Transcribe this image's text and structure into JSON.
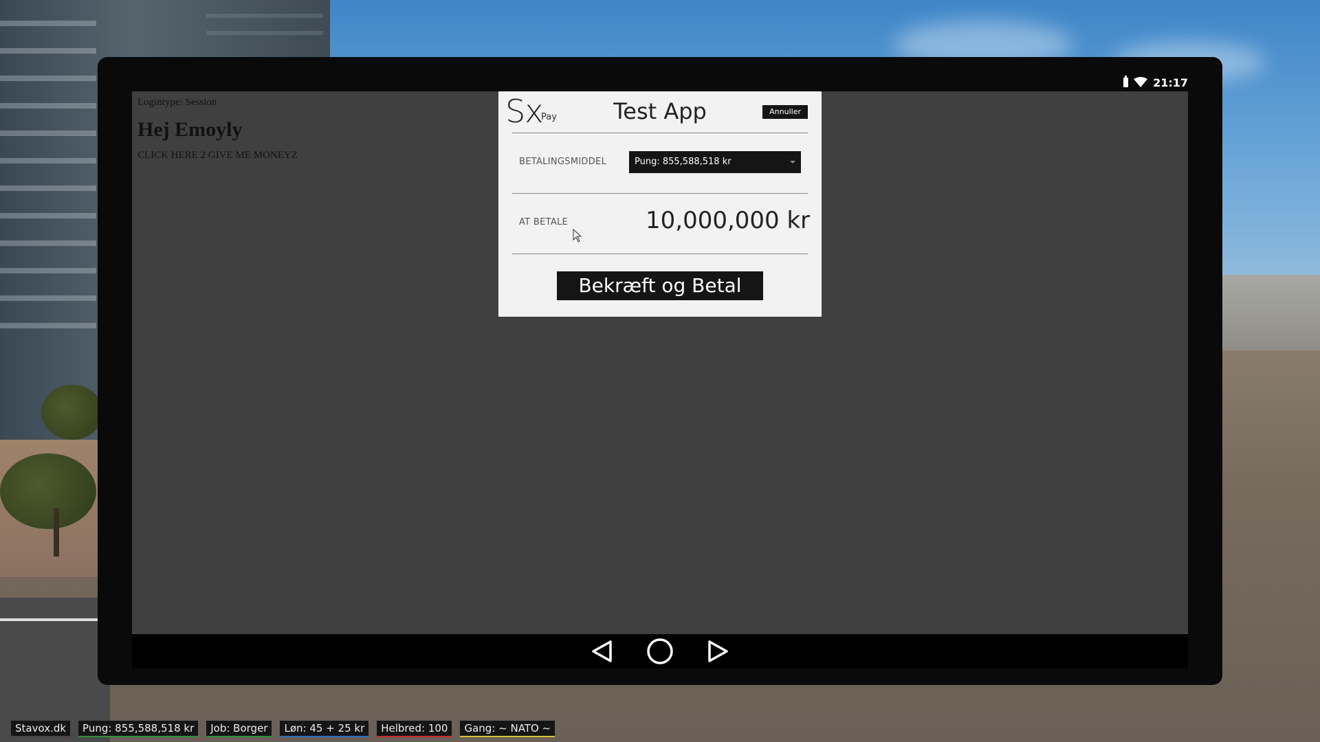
{
  "tablet": {
    "status_time": "21:17",
    "page": {
      "login_type": "Logintype: Session",
      "greeting": "Hej Emoyly",
      "money_link": "CLICK HERE 2 GIVE ME MONEYZ"
    },
    "nav": [
      "back-icon",
      "home-icon",
      "forward-icon"
    ]
  },
  "payment_dialog": {
    "logo": "Sx",
    "logo_sub": "Pay",
    "app_title": "Test App",
    "cancel_label": "Annuller",
    "method_label": "BETALINGSMIDDEL",
    "method_value": "Pung: 855,588,518 kr",
    "amount_label": "AT BETALE",
    "amount_value": "10,000,000 kr",
    "confirm_label": "Bekræft og Betal"
  },
  "hud": {
    "items": [
      {
        "label": "Stavox.dk",
        "accent": "#444444"
      },
      {
        "label": "Pung: 855,588,518 kr",
        "accent": "#2f8f3a"
      },
      {
        "label": "Job: Borger",
        "accent": "#2f8f3a"
      },
      {
        "label": "Løn: 45 + 25 kr",
        "accent": "#2d6fc4"
      },
      {
        "label": "Helbred: 100",
        "accent": "#c62b2b"
      },
      {
        "label": "Gang: ~ NATO ~",
        "accent": "#d8c23a"
      }
    ]
  }
}
